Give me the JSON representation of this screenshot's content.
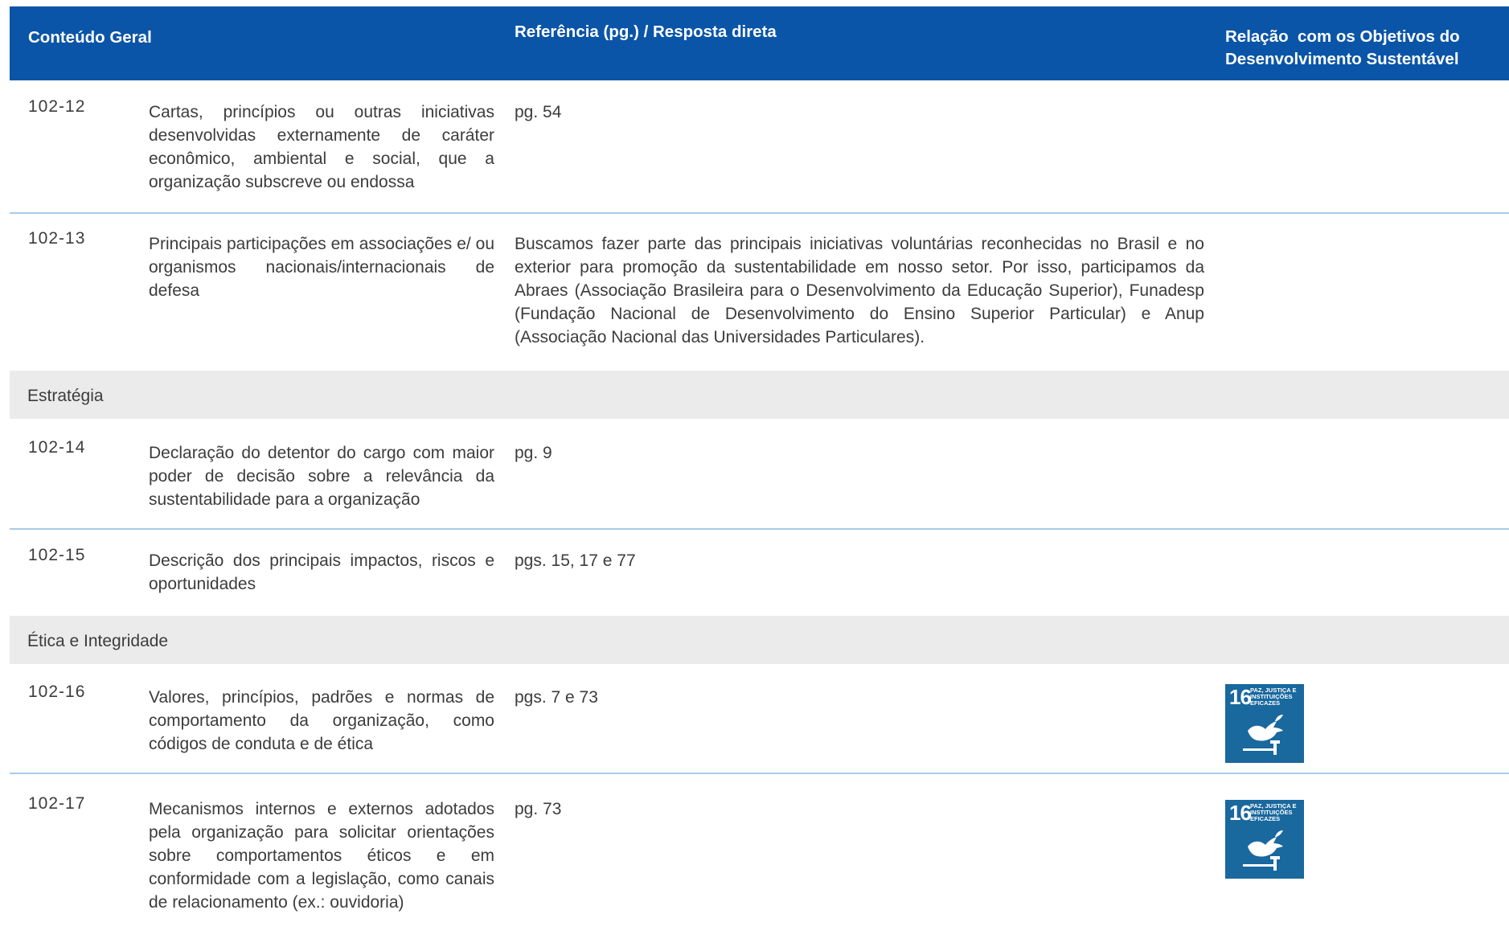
{
  "header": {
    "col1": "Conteúdo Geral",
    "col2": "Referência (pg.) / Resposta direta",
    "col3": "Relação  com os Objetivos do\nDesenvolvimento Sustentável"
  },
  "rows": [
    {
      "code": "102-12",
      "description": "Cartas, princípios ou outras iniciativas desenvolvidas externamente de caráter econômico, ambiental e social, que a organização subscreve ou endossa",
      "reference": "pg. 54"
    },
    {
      "code": "102-13",
      "description": "Principais participações em associações e/ ou organismos nacionais/internacionais de defesa",
      "reference": "Buscamos fazer parte das principais iniciativas voluntárias reconhecidas no Brasil e no exterior para promoção da sustentabilidade em nosso setor. Por isso, participamos da Abraes (Associação Brasileira para o Desenvolvimento da Educação Superior), Funadesp (Fundação Nacional de Desenvolvimento do Ensino Superior Particular) e Anup (Associação Nacional das Universidades Particulares)."
    },
    {
      "code": "102-14",
      "description": "Declaração do detentor do cargo com maior poder de decisão sobre a relevância da sustentabilidade para a organização",
      "reference": "pg. 9"
    },
    {
      "code": "102-15",
      "description": "Descrição dos principais impactos, riscos e oportunidades",
      "reference": "pgs. 15, 17 e 77"
    },
    {
      "code": "102-16",
      "description": "Valores, princípios, padrões e normas de comportamento da organização, como códigos de conduta e de ética",
      "reference": "pgs. 7 e 73",
      "sdg": {
        "number": "16",
        "label": "PAZ, JUSTIÇA E INSTITUIÇÕES EFICAZES",
        "icon": "dove-gavel-icon",
        "color": "#19689e"
      }
    },
    {
      "code": "102-17",
      "description": "Mecanismos internos e externos adotados pela organização para solicitar orientações sobre comportamentos éticos e em conformidade com a legislação, como canais de relacionamento (ex.: ouvidoria)",
      "reference": "pg. 73",
      "sdg": {
        "number": "16",
        "label": "PAZ, JUSTIÇA E INSTITUIÇÕES EFICAZES",
        "icon": "dove-gavel-icon",
        "color": "#19689e"
      }
    }
  ],
  "sections": {
    "estrategia": "Estratégia",
    "etica": "Ética e Integridade"
  },
  "colors": {
    "header_bg": "#0a55a7",
    "row_divider": "#a8cbe8",
    "section_bg": "#ebebeb",
    "sdg16": "#19689e"
  }
}
